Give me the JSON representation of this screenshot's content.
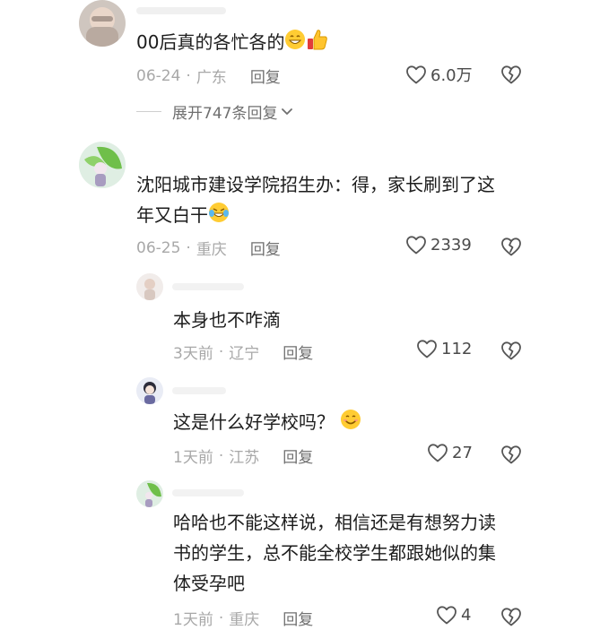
{
  "comments": [
    {
      "text": "00后真的各忙各的",
      "date": "06-24",
      "location": "广东",
      "reply_label": "回复",
      "likes": "6.0万",
      "expand_label": "展开747条回复"
    },
    {
      "text_line1": "沈阳城市建设学院招生办：得，家长刷到了这",
      "text_line2": "年又白干",
      "date": "06-25",
      "location": "重庆",
      "reply_label": "回复",
      "likes": "2339"
    }
  ],
  "replies": [
    {
      "text": "本身也不咋滴",
      "date": "3天前",
      "location": "辽宁",
      "reply_label": "回复",
      "likes": "112"
    },
    {
      "text": "这是什么好学校吗？",
      "date": "1天前",
      "location": "江苏",
      "reply_label": "回复",
      "likes": "27"
    },
    {
      "text_line1": "哈哈也不能这样说，相信还是有想努力读",
      "text_line2": "书的学生，总不能全校学生都跟她似的集",
      "text_line3": "体受孕吧",
      "date": "1天前",
      "location": "重庆",
      "reply_label": "回复",
      "likes": "4"
    }
  ],
  "meta_separator": "·",
  "icons": {
    "like": "heart-outline-icon",
    "dislike": "broken-heart-icon",
    "expand": "chevron-down-icon",
    "emoji_grin": "grinning-face-emoji",
    "emoji_thumbs": "thumbs-up-emoji",
    "emoji_tears": "tears-of-joy-emoji",
    "emoji_smile": "smiling-face-emoji"
  }
}
